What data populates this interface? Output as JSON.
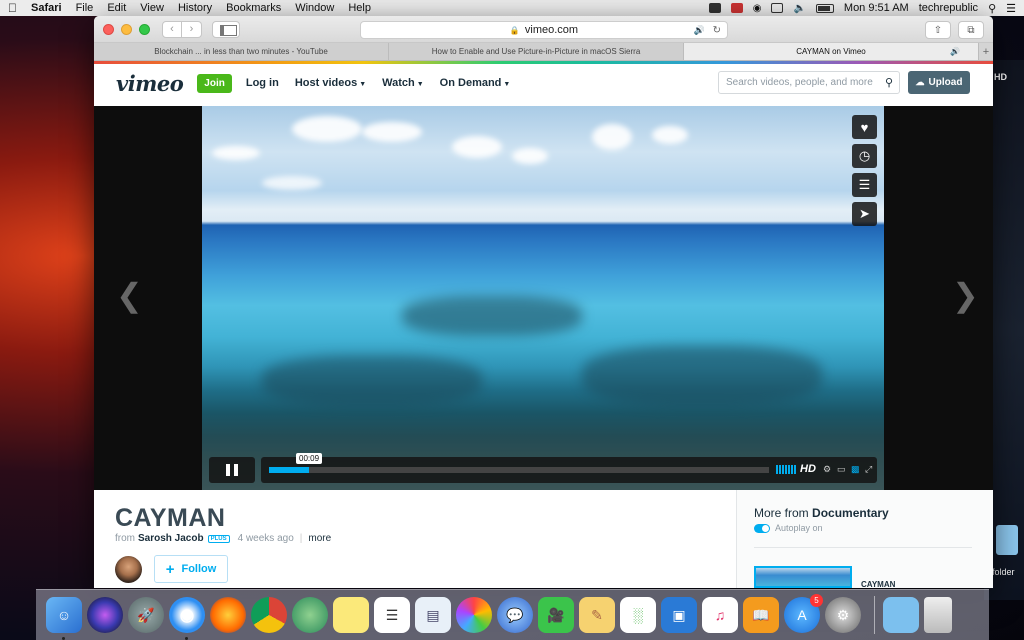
{
  "menubar": {
    "app": "Safari",
    "items": [
      "File",
      "Edit",
      "View",
      "History",
      "Bookmarks",
      "Window",
      "Help"
    ],
    "clock": "Mon 9:51 AM",
    "user": "techrepublic"
  },
  "desktop": {
    "hd_label": "HD",
    "folder_label": "folder"
  },
  "browser": {
    "address": "vimeo.com",
    "tabs": [
      {
        "title": "Blockchain ... in less than two minutes - YouTube"
      },
      {
        "title": "How to Enable and Use Picture-in-Picture in macOS Sierra"
      },
      {
        "title": "CAYMAN on Vimeo"
      }
    ]
  },
  "vimeo": {
    "logo": "vimeo",
    "join": "Join",
    "login": "Log in",
    "nav": [
      "Host videos",
      "Watch",
      "On Demand"
    ],
    "search_placeholder": "Search videos, people, and more",
    "upload": "Upload"
  },
  "player": {
    "current_time": "00:09",
    "progress": 0.08,
    "hd": "HD"
  },
  "video_info": {
    "title": "CAYMAN",
    "from": "from",
    "author": "Sarosh Jacob",
    "badge": "PLUS",
    "posted": "4 weeks ago",
    "more": "more",
    "follow": "Follow"
  },
  "sidebar": {
    "more_from_prefix": "More from",
    "more_from_channel": "Documentary",
    "autoplay": "Autoplay on",
    "next_title": "CAYMAN"
  },
  "dock": {
    "badge_count": "5"
  },
  "colors": {
    "vimeo_blue": "#00adef",
    "join_green": "#4ab81a",
    "upload_gray": "#4b6674"
  }
}
